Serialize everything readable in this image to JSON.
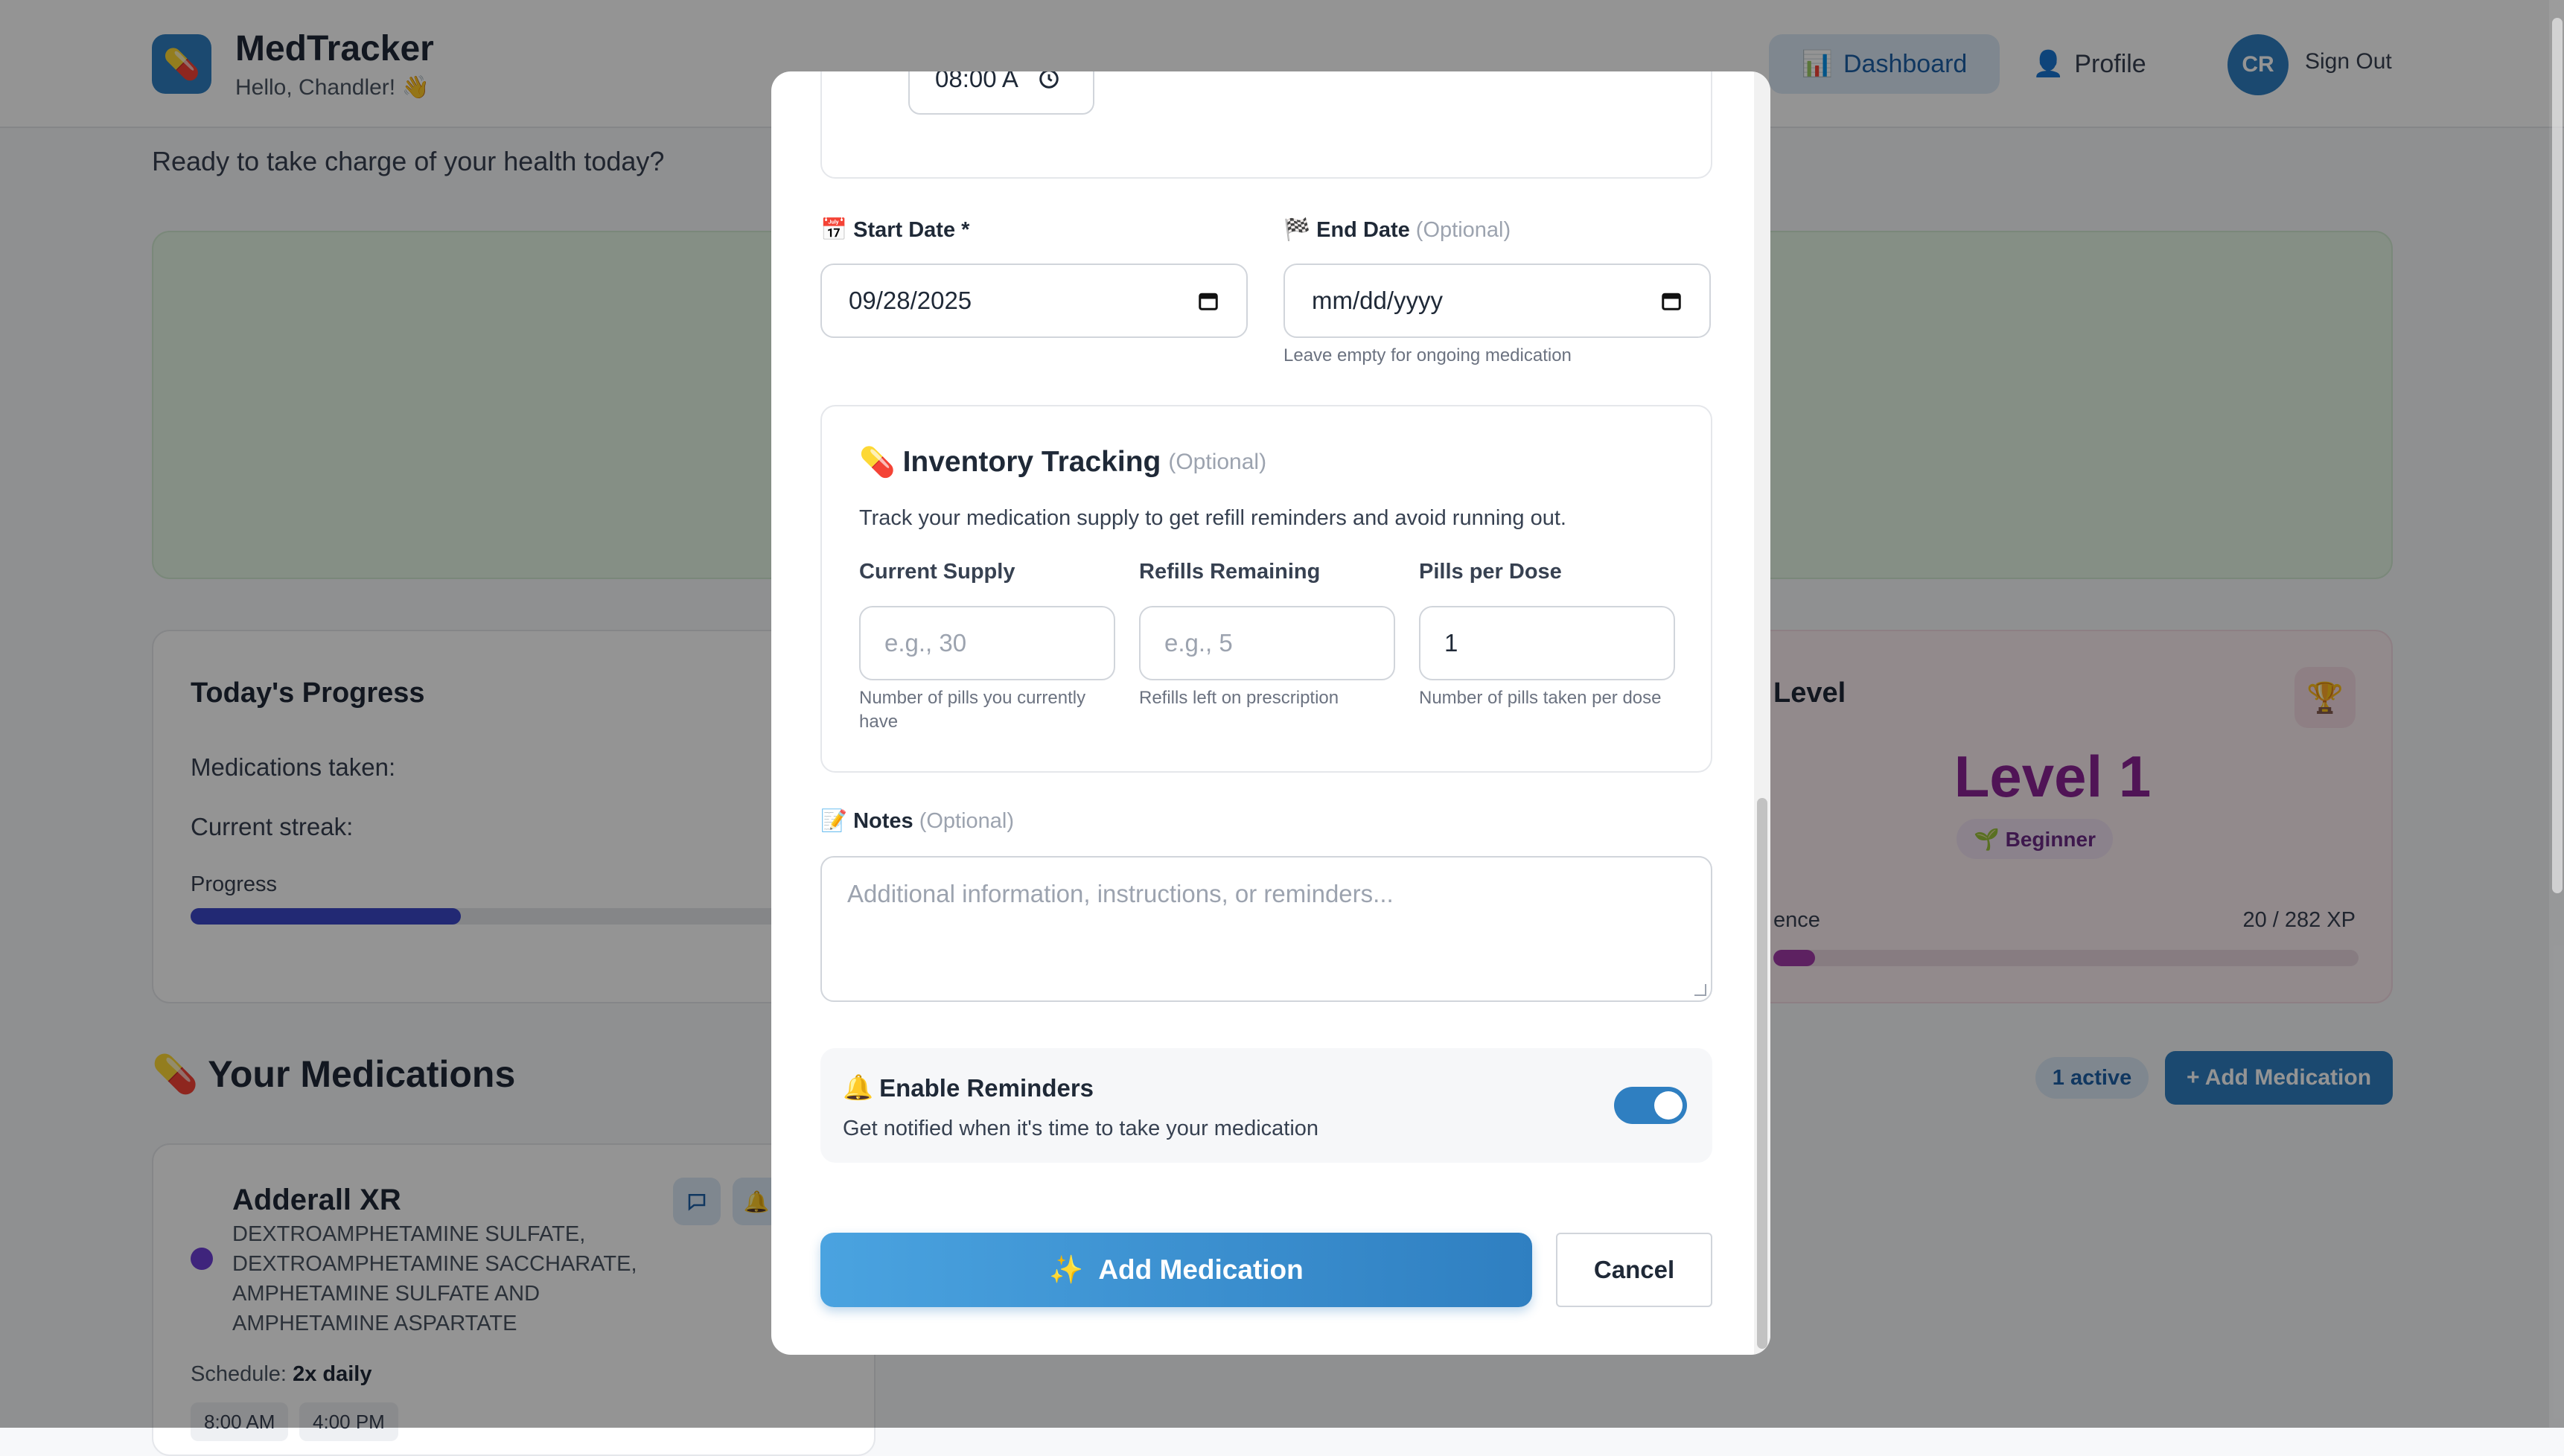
{
  "app": {
    "name": "MedTracker",
    "greeting": "Hello, Chandler! 👋",
    "logo_icon": "💊",
    "nav": {
      "dashboard": {
        "label": "Dashboard",
        "icon": "📊"
      },
      "profile": {
        "label": "Profile",
        "icon": "👤"
      }
    },
    "user_initials": "CR",
    "sign_out": "Sign Out"
  },
  "tagline": "Ready to take charge of your health today?",
  "progress_card": {
    "title": "Today's Progress",
    "taken_label": "Medications taken:",
    "streak_label": "Current streak:",
    "progress_label": "Progress",
    "progress_fraction": 0.33
  },
  "level_card": {
    "title": "Level",
    "trophy_icon": "🏆",
    "level": "Level 1",
    "badge": "🌱 Beginner",
    "xp_label": "ence",
    "xp_value": "20 / 282 XP",
    "xp_fraction": 0.071
  },
  "medications": {
    "title": "💊 Your Medications",
    "active_count": "1 active",
    "add_button": "+ Add Medication",
    "items": [
      {
        "name": "Adderall XR",
        "ingredients": "DEXTROAMPHETAMINE SULFATE, DEXTROAMPHETAMINE SACCHARATE, AMPHETAMINE SULFATE AND AMPHETAMINE ASPARTATE",
        "color": "#6d3fd6",
        "schedule_label": "Schedule:",
        "schedule_value": "2x daily",
        "times": [
          "8:00 AM",
          "4:00 PM"
        ]
      }
    ]
  },
  "modal": {
    "time_value": "08:00 A",
    "start_date": {
      "label": "Start Date *",
      "icon": "📅",
      "value": "09/28/2025"
    },
    "end_date": {
      "label": "End Date",
      "optional": "(Optional)",
      "icon": "🏁",
      "placeholder": "mm/dd/yyyy",
      "hint": "Leave empty for ongoing medication"
    },
    "inventory": {
      "icon": "💊",
      "title": "Inventory Tracking",
      "optional": "(Optional)",
      "description": "Track your medication supply to get refill reminders and avoid running out.",
      "fields": [
        {
          "label": "Current Supply",
          "placeholder": "e.g., 30",
          "value": "",
          "hint": "Number of pills you currently have"
        },
        {
          "label": "Refills Remaining",
          "placeholder": "e.g., 5",
          "value": "",
          "hint": "Refills left on prescription"
        },
        {
          "label": "Pills per Dose",
          "placeholder": "",
          "value": "1",
          "hint": "Number of pills taken per dose"
        }
      ]
    },
    "notes": {
      "icon": "📝",
      "label": "Notes",
      "optional": "(Optional)",
      "placeholder": "Additional information, instructions, or reminders..."
    },
    "reminders": {
      "icon": "🔔",
      "title": "Enable Reminders",
      "subtitle": "Get notified when it's time to take your medication",
      "enabled": true
    },
    "submit": {
      "icon": "✨",
      "label": "Add Medication"
    },
    "cancel": "Cancel"
  }
}
